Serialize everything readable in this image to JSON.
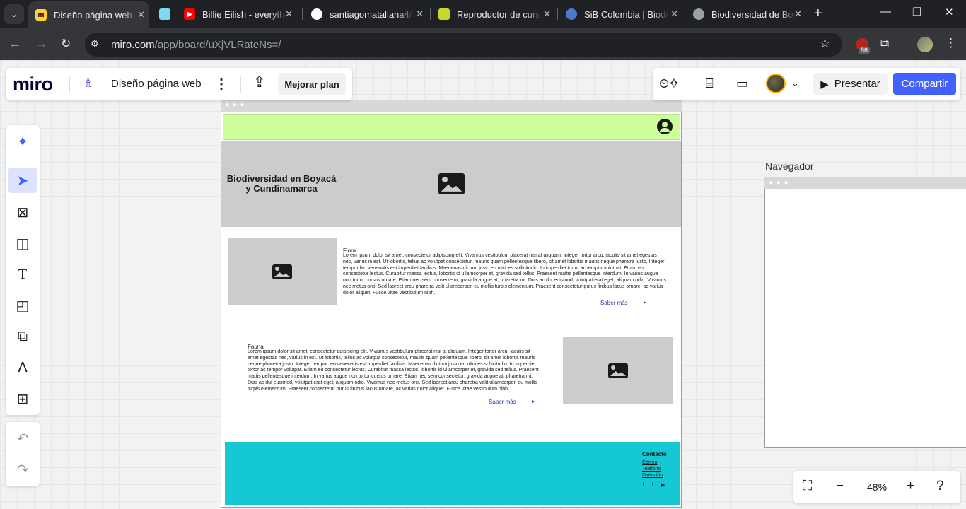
{
  "browser": {
    "tabs": [
      {
        "title": "Diseño página web",
        "active": true,
        "favicon_color": "#ffd02f"
      },
      {
        "title": "",
        "active": false,
        "favicon_color": "#7fd8f0"
      },
      {
        "title": "Billie Eilish - everythi",
        "active": false,
        "favicon_color": "#ff0000"
      },
      {
        "title": "santiagomatallana4/",
        "active": false,
        "favicon_color": "#ffffff"
      },
      {
        "title": "Reproductor de curs",
        "active": false,
        "favicon_color": "#c7d82a"
      },
      {
        "title": "SiB Colombia | Biodi",
        "active": false,
        "favicon_color": "#4a7bd0"
      },
      {
        "title": "Biodiversidad de Boy",
        "active": false,
        "favicon_color": "#9aa0a6"
      }
    ],
    "url_host": "miro.com",
    "url_path": "/app/board/uXjVLRateNs=/",
    "extension_badge": "86"
  },
  "miro": {
    "logo": "miro",
    "board_name": "Diseño página web",
    "upgrade_label": "Mejorar plan",
    "present_label": "Presentar",
    "share_label": "Compartir",
    "zoom": "48%",
    "brand_color": "#4262ff"
  },
  "wireframe": {
    "hero_title": "Biodiversidad en Boyacá y Cundinamarca",
    "flora": {
      "title": "Flora",
      "text": "Lorem ipsum dolor sit amet, consectetur adipiscing elit. Vivamus vestibulum placerat nisi at aliquam. Integer tortor arcu, iaculis sit amet egestas nec, varius in est. Ut lobortis, tellus ac volutpat consectetur, mauris quam pellentesque libero, sit amet lobortis mauris neque pharetra justo. Integer tempor leo venenatis est imperdiet facilisis. Maecenas dictum justo eu ultrices sollicitudin. In imperdiet tortor ac tempor volutpat. Etiam eu consectetur lectus. Curabitur massa lectus, lobortis id ullamcorper et, gravida sed tellus. Praesent mattis pellentesque interdum. In varius augue non tortor cursus ornare. Etiam nec sem consectetur, gravida augue at, pharetra mi. Duis ac dui euismod, volutpat erat eget, aliquam odio. Vivamus nec metus orci. Sed laoreet arcu pharetra velit ullamcorper, eu mollis turpis elementum. Praesent consectetur purus finibus lacus ornare, ac varius dolor aliquet. Fusce vitae vestibulum nibh.",
      "more": "Saber más"
    },
    "fauna": {
      "title": "Fauna",
      "text": "Lorem ipsum dolor sit amet, consectetur adipiscing elit. Vivamus vestibulum placerat nisi at aliquam. Integer tortor arcu, iaculis sit amet egestas nec, varius in est. Ut lobortis, tellus ac volutpat consectetur, mauris quam pellentesque libero, sit amet lobortis mauris neque pharetra justo. Integer tempor leo venenatis est imperdiet facilisis. Maecenas dictum justo eu ultrices sollicitudin. In imperdiet tortor ac tempor volutpat. Etiam eu consectetur lectus. Curabitur massa lectus, lobortis id ullamcorper et, gravida sed tellus. Praesent mattis pellentesque interdum. In varius augue non tortor cursus ornare. Etiam nec sem consectetur, gravida augue at, pharetra mi. Duis ac dui euismod, volutpat erat eget, aliquam odio. Vivamus nec metus orci. Sed laoreet arcu pharetra velit ullamcorper, eu mollis turpis elementum. Praesent consectetur purus finibus lacus ornare, ac varius dolor aliquet. Fusce vitae vestibulum nibh.",
      "more": "Saber más"
    },
    "footer": {
      "title": "Contacto",
      "links": [
        "Correo",
        "Teléfono",
        "Dirección"
      ],
      "social": [
        "f",
        "t",
        "▶"
      ]
    },
    "colors": {
      "nav": "#ccff99",
      "placeholder": "#cccccc",
      "footer": "#14c8d4"
    }
  },
  "navigator": {
    "label": "Navegador"
  }
}
